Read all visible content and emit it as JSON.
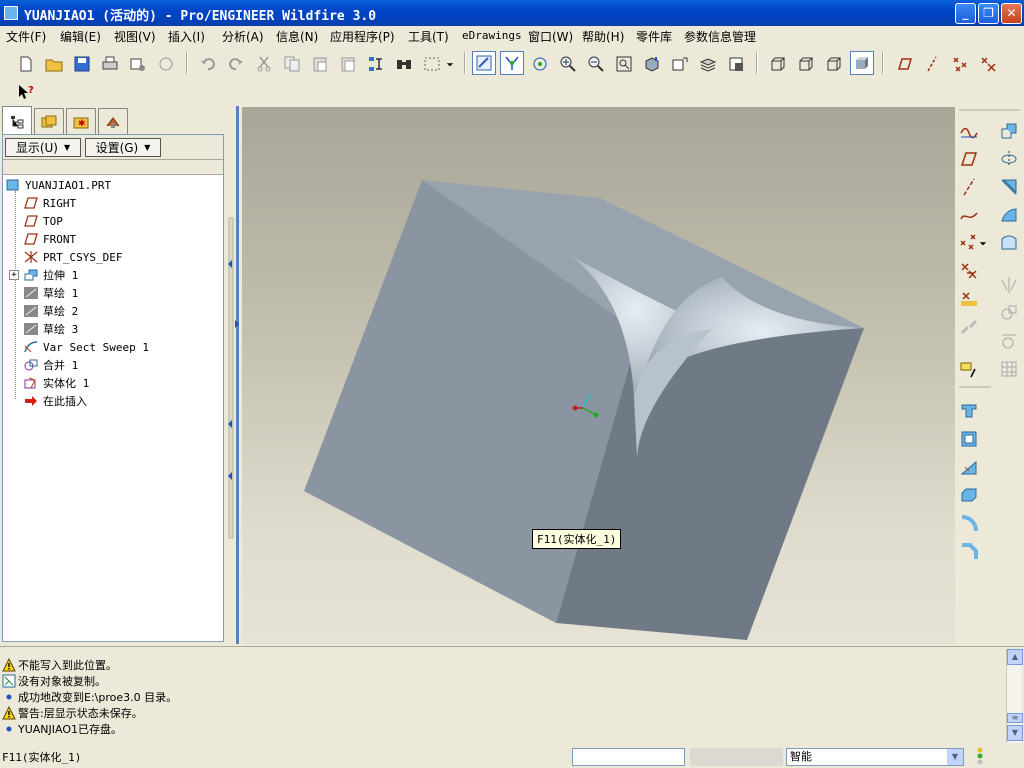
{
  "window": {
    "title": "YUANJIAO1 (活动的) - Pro/ENGINEER Wildfire 3.0",
    "buttons": {
      "minimize": "_",
      "restore": "❐",
      "close": "✕"
    }
  },
  "menu": {
    "items": [
      {
        "label": "文件(F)"
      },
      {
        "label": "编辑(E)"
      },
      {
        "label": "视图(V)"
      },
      {
        "label": "插入(I)"
      },
      {
        "label": "分析(A)"
      },
      {
        "label": "信息(N)"
      },
      {
        "label": "应用程序(P)"
      },
      {
        "label": "工具(T)"
      },
      {
        "label": "eDrawings"
      },
      {
        "label": "窗口(W)"
      },
      {
        "label": "帮助(H)"
      },
      {
        "label": "零件库"
      },
      {
        "label": "参数信息管理"
      }
    ]
  },
  "toolbar": {
    "icons": [
      "new-file-icon",
      "open-folder-icon",
      "save-icon",
      "print-icon",
      "send-mail-icon",
      "mail-recipient-icon",
      "undo-icon",
      "redo-icon",
      "cut-icon",
      "copy-icon",
      "paste-icon",
      "paste-special-icon",
      "regenerate-icon",
      "find-icon",
      "select-box-icon",
      "repaint-icon",
      "spin-center-icon",
      "orient-mode-icon",
      "zoom-in-icon",
      "zoom-out-icon",
      "refit-icon",
      "reorient-icon",
      "saved-views-icon",
      "layers-icon",
      "view-manager-icon",
      "wireframe-icon",
      "hidden-line-icon",
      "no-hidden-icon",
      "shading-icon",
      "datum-planes-icon",
      "datum-axes-icon",
      "datum-points-icon",
      "csys-icon",
      "context-help-icon"
    ]
  },
  "nav": {
    "show_button": "显示(U)",
    "settings_button": "设置(G)",
    "tree": [
      {
        "label": "YUANJIAO1.PRT",
        "icon": "part-icon"
      },
      {
        "label": "RIGHT",
        "icon": "datum-plane-icon"
      },
      {
        "label": "TOP",
        "icon": "datum-plane-icon"
      },
      {
        "label": "FRONT",
        "icon": "datum-plane-icon"
      },
      {
        "label": "PRT_CSYS_DEF",
        "icon": "csys-icon"
      },
      {
        "label": "拉伸 1",
        "icon": "extrude-icon"
      },
      {
        "label": "草绘 1",
        "icon": "sketch-icon"
      },
      {
        "label": "草绘 2",
        "icon": "sketch-icon"
      },
      {
        "label": "草绘 3",
        "icon": "sketch-icon"
      },
      {
        "label": "Var Sect Sweep 1",
        "icon": "sweep-icon"
      },
      {
        "label": "合并 1",
        "icon": "merge-icon"
      },
      {
        "label": "实体化 1",
        "icon": "solidify-icon"
      },
      {
        "label": "在此插入",
        "icon": "insert-here-icon"
      }
    ],
    "expand_symbol": "+"
  },
  "viewport": {
    "tooltip": "F11(实体化_1)"
  },
  "messages": [
    {
      "type": "warning",
      "text": "不能写入到此位置。"
    },
    {
      "type": "info-box",
      "text": "没有对象被复制。"
    },
    {
      "type": "bullet",
      "text": "成功地改变到E:\\proe3.0 目录。"
    },
    {
      "type": "warning",
      "text": "警告:层显示状态未保存。"
    },
    {
      "type": "bullet",
      "text": "YUANJIAO1已存盘。"
    }
  ],
  "status": {
    "text": "F11(实体化_1)",
    "filter_value": "智能"
  },
  "colors": {
    "title_bar": "#0046c8",
    "bg": "#ece9d8",
    "model_top": "#98a3ae",
    "model_front": "#8a95a1",
    "model_side": "#6f7a86"
  }
}
